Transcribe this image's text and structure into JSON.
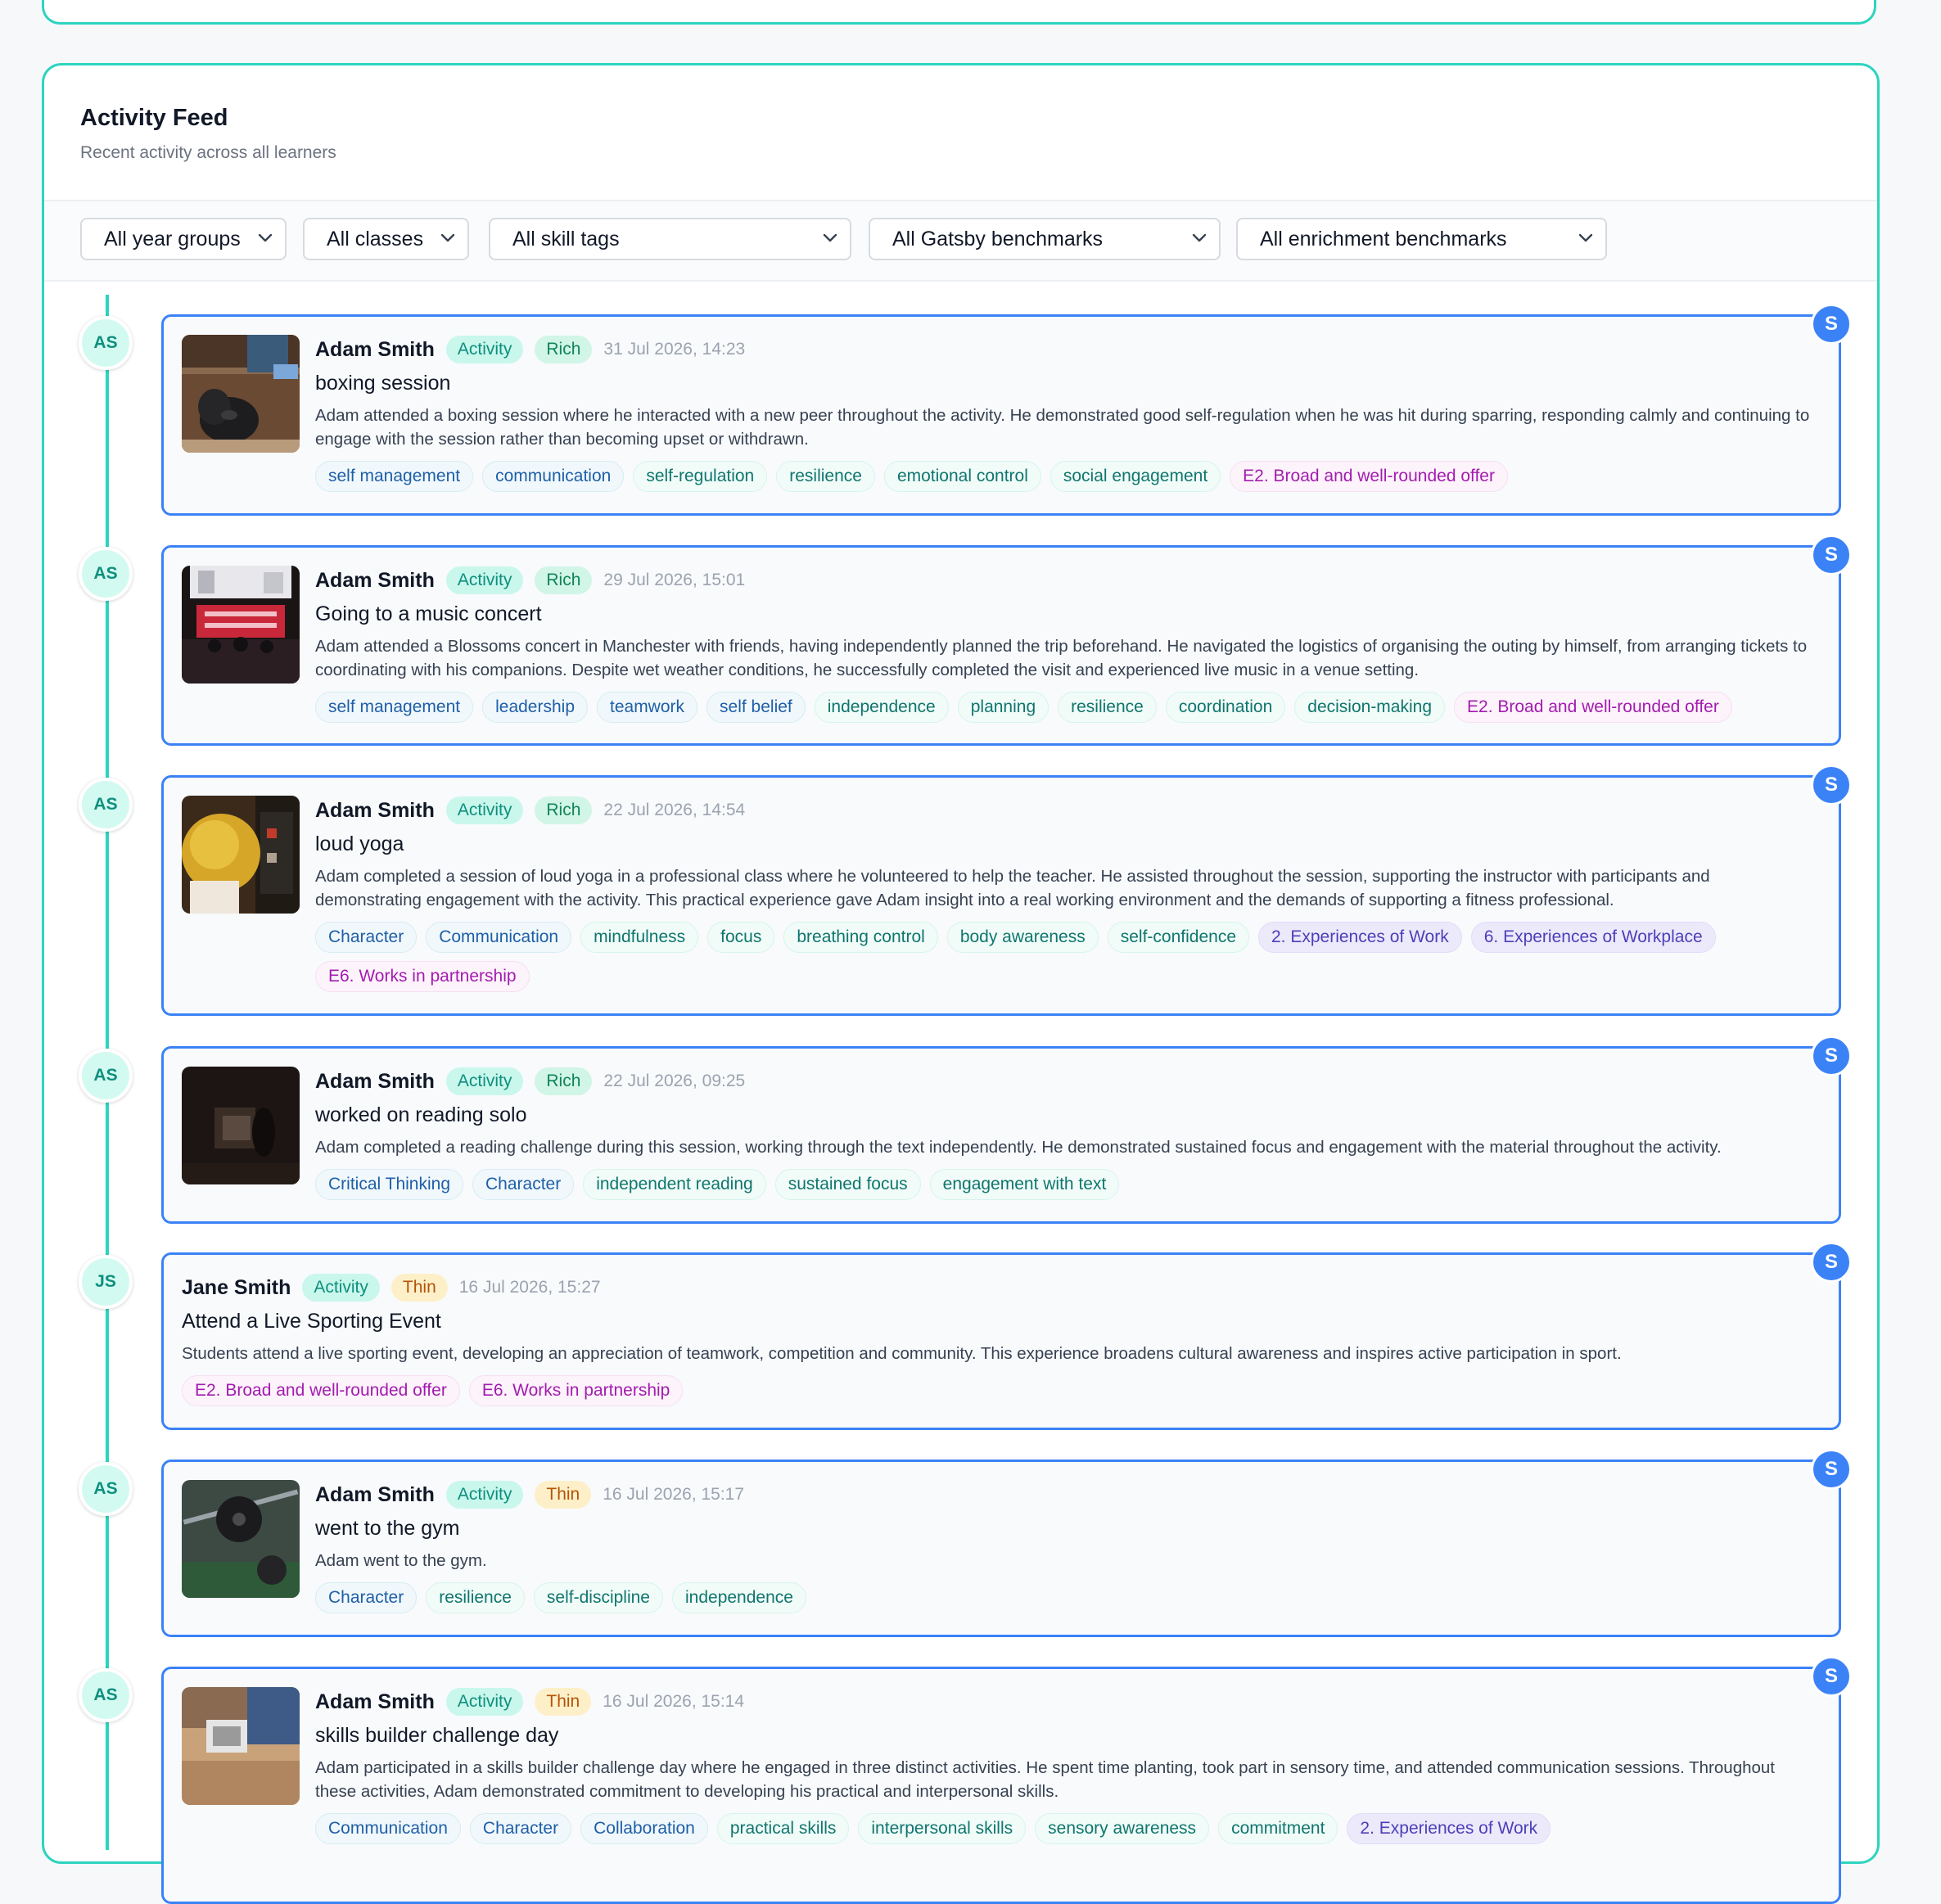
{
  "feed": {
    "title": "Activity Feed",
    "subtitle": "Recent activity across all learners"
  },
  "filters": {
    "year_groups": "All year groups",
    "classes": "All classes",
    "skill_tags": "All skill tags",
    "gatsby": "All Gatsby benchmarks",
    "enrichment": "All enrichment benchmarks"
  },
  "colors": {
    "accent_teal": "#2dd4bf",
    "card_border": "#3b82f6",
    "enrichment_tag": "#a21caf",
    "gatsby_tag": "#4c3fb8"
  },
  "entries": [
    {
      "initials": "AS",
      "badge": "S",
      "image": "boxing-gloves-photo",
      "name": "Adam Smith",
      "type": "Activity",
      "quality": "Rich",
      "date": "31 Jul 2026, 14:23",
      "title": "boxing session",
      "description": "Adam attended a boxing session where he interacted with a new peer throughout the activity. He demonstrated good self-regulation when he was hit during sparring, responding calmly and continuing to engage with the session rather than becoming upset or withdrawn.",
      "tags": [
        "self management",
        "communication",
        "self-regulation",
        "resilience",
        "emotional control",
        "social engagement",
        "E2. Broad and well-rounded offer"
      ]
    },
    {
      "initials": "AS",
      "badge": "S",
      "image": "concert-photo",
      "name": "Adam Smith",
      "type": "Activity",
      "quality": "Rich",
      "date": "29 Jul 2026, 15:01",
      "title": "Going to a music concert",
      "description": "Adam attended a Blossoms concert in Manchester with friends, having independently planned the trip beforehand. He navigated the logistics of organising the outing by himself, from arranging tickets to coordinating with his companions. Despite wet weather conditions, he successfully completed the visit and experienced live music in a venue setting.",
      "tags": [
        "self management",
        "leadership",
        "teamwork",
        "self belief",
        "independence",
        "planning",
        "resilience",
        "coordination",
        "decision-making",
        "E2. Broad and well-rounded offer"
      ]
    },
    {
      "initials": "AS",
      "badge": "S",
      "image": "yoga-photo",
      "name": "Adam Smith",
      "type": "Activity",
      "quality": "Rich",
      "date": "22 Jul 2026, 14:54",
      "title": "loud yoga",
      "description": "Adam completed a session of loud yoga in a professional class where he volunteered to help the teacher. He assisted throughout the session, supporting the instructor with participants and demonstrating engagement with the activity. This practical experience gave Adam insight into a real working environment and the demands of supporting a fitness professional.",
      "tags": [
        "Character",
        "Communication",
        "mindfulness",
        "focus",
        "breathing control",
        "body awareness",
        "self-confidence",
        "2. Experiences of Work",
        "6. Experiences of Workplace",
        "E6. Works in partnership"
      ]
    },
    {
      "initials": "AS",
      "badge": "S",
      "image": "reading-photo",
      "name": "Adam Smith",
      "type": "Activity",
      "quality": "Rich",
      "date": "22 Jul 2026, 09:25",
      "title": "worked on reading solo",
      "description": "Adam completed a reading challenge during this session, working through the text independently. He demonstrated sustained focus and engagement with the material throughout the activity.",
      "tags": [
        "Critical Thinking",
        "Character",
        "independent reading",
        "sustained focus",
        "engagement with text"
      ]
    },
    {
      "initials": "JS",
      "badge": "S",
      "image": "",
      "name": "Jane Smith",
      "type": "Activity",
      "quality": "Thin",
      "date": "16 Jul 2026, 15:27",
      "title": "Attend a Live Sporting Event",
      "description": "Students attend a live sporting event, developing an appreciation of teamwork, competition and community. This experience broadens cultural awareness and inspires active participation in sport.",
      "tags": [
        "E2. Broad and well-rounded offer",
        "E6. Works in partnership"
      ]
    },
    {
      "initials": "AS",
      "badge": "S",
      "image": "gym-weights-photo",
      "name": "Adam Smith",
      "type": "Activity",
      "quality": "Thin",
      "date": "16 Jul 2026, 15:17",
      "title": "went to the gym",
      "description": "Adam went to the gym.",
      "tags": [
        "Character",
        "resilience",
        "self-discipline",
        "independence"
      ]
    },
    {
      "initials": "AS",
      "badge": "S",
      "image": "woodwork-photo",
      "name": "Adam Smith",
      "type": "Activity",
      "quality": "Thin",
      "date": "16 Jul 2026, 15:14",
      "title": "skills builder challenge day",
      "description": "Adam participated in a skills builder challenge day where he engaged in three distinct activities. He spent time planting, took part in sensory time, and attended communication sessions. Throughout these activities, Adam demonstrated commitment to developing his practical and interpersonal skills.",
      "tags": [
        "Communication",
        "Character",
        "Collaboration",
        "practical skills",
        "interpersonal skills",
        "sensory awareness",
        "commitment",
        "2. Experiences of Work"
      ]
    }
  ]
}
